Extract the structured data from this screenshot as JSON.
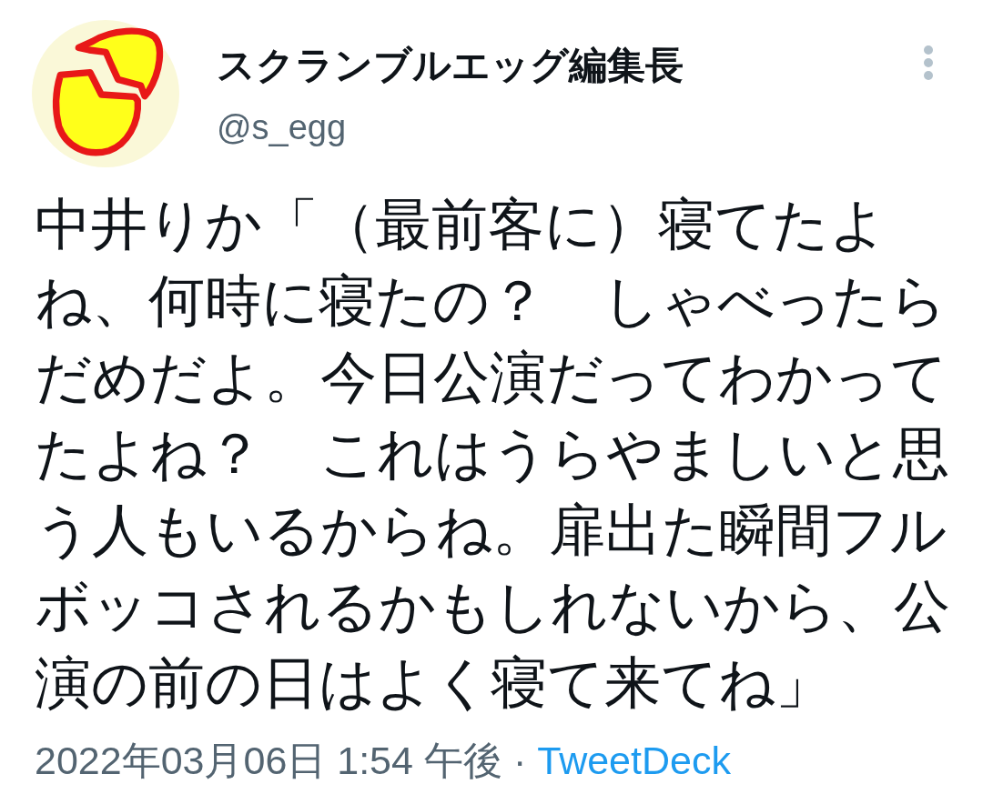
{
  "author": {
    "display_name": "スクランブルエッグ編集長",
    "handle": "@s_egg"
  },
  "tweet": {
    "text": "中井りか「（最前客に）寝てたよね、何時に寝たの？　しゃべったらだめだよ。今日公演だってわかってたよね？　これはうらやましいと思う人もいるからね。扉出た瞬間フルボッコされるかもしれないから、公演の前の日はよく寝て来てね」",
    "timestamp": "2022年03月06日 1:54 午後",
    "separator": "·",
    "source": "TweetDeck"
  }
}
